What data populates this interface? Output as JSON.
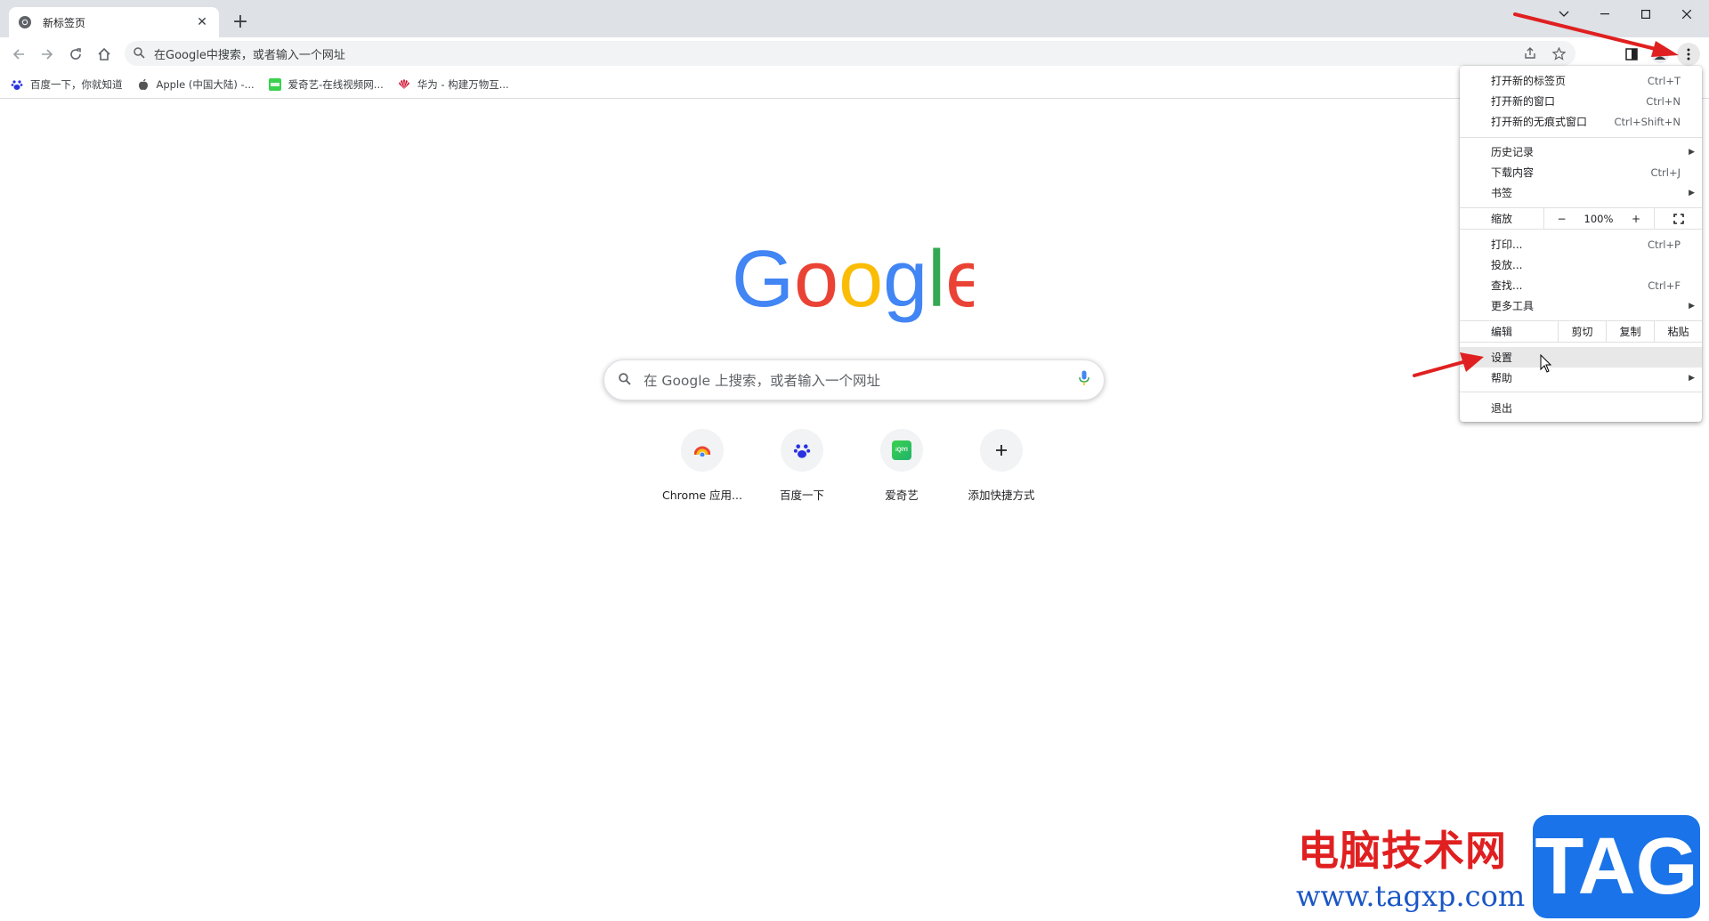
{
  "tab": {
    "title": "新标签页"
  },
  "omnibox": {
    "placeholder": "在Google中搜索，或者输入一个网址"
  },
  "bookmarks": [
    {
      "label": "百度一下，你就知道",
      "icon": "baidu-icon"
    },
    {
      "label": "Apple (中国大陆) -...",
      "icon": "apple-icon"
    },
    {
      "label": "爱奇艺-在线视频网...",
      "icon": "iqiyi-icon"
    },
    {
      "label": "华为 - 构建万物互...",
      "icon": "huawei-icon"
    }
  ],
  "ntp": {
    "logo": "Google",
    "search_placeholder": "在 Google 上搜索，或者输入一个网址",
    "shortcuts": [
      {
        "label": "Chrome 应用...",
        "icon": "chrome-web-store-icon"
      },
      {
        "label": "百度一下",
        "icon": "baidu-icon"
      },
      {
        "label": "爱奇艺",
        "icon": "iqiyi-icon",
        "icon_text": "iQIYI"
      },
      {
        "label": "添加快捷方式",
        "icon": "plus-icon"
      }
    ]
  },
  "menu": {
    "new_tab": {
      "label": "打开新的标签页",
      "shortcut": "Ctrl+T"
    },
    "new_window": {
      "label": "打开新的窗口",
      "shortcut": "Ctrl+N"
    },
    "incognito": {
      "label": "打开新的无痕式窗口",
      "shortcut": "Ctrl+Shift+N"
    },
    "history": {
      "label": "历史记录"
    },
    "downloads": {
      "label": "下载内容",
      "shortcut": "Ctrl+J"
    },
    "bookmarks": {
      "label": "书签"
    },
    "zoom": {
      "label": "缩放",
      "minus": "−",
      "value": "100%",
      "plus": "+"
    },
    "print": {
      "label": "打印...",
      "shortcut": "Ctrl+P"
    },
    "cast": {
      "label": "投放..."
    },
    "find": {
      "label": "查找...",
      "shortcut": "Ctrl+F"
    },
    "more_tools": {
      "label": "更多工具"
    },
    "edit": {
      "label": "编辑",
      "cut": "剪切",
      "copy": "复制",
      "paste": "粘贴"
    },
    "settings": {
      "label": "设置"
    },
    "help": {
      "label": "帮助"
    },
    "exit": {
      "label": "退出"
    }
  },
  "watermark": {
    "title": "电脑技术网",
    "url": "www.tagxp.com",
    "tag": "TAG"
  },
  "colors": {
    "annotation_arrow": "#e02020",
    "menu_hover": "#e8e8e8"
  }
}
